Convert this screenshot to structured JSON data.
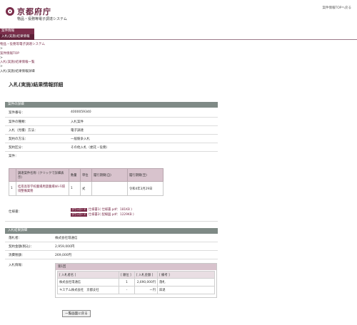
{
  "header": {
    "logo_text": "京都府庁",
    "system_name": "物品・役務等電子調達システム",
    "top_link": "案件情報TOPへ戻る"
  },
  "nav": {
    "tab1": "案件情報",
    "tab2": "入札(実施)結果情報"
  },
  "breadcrumb": {
    "item1": "物品・役務等電子調達システム",
    "sep": ">",
    "item2": "案件情報TOP",
    "item3": "入札(実施)結果情報一覧",
    "current": "入札(実施)結果情報詳細"
  },
  "page_title": "入札(実施)結果情報詳細",
  "details": {
    "section_title": "案件の詳細",
    "rows": [
      {
        "label": "案件番号：",
        "value": "4000059340"
      },
      {
        "label": "案件の種類：",
        "value": "入札案件"
      },
      {
        "label": "入札（見積）方法：",
        "value": "電子調達"
      },
      {
        "label": "契約の方法：",
        "value": "一般競争入札"
      },
      {
        "label": "契約区分：",
        "value": "その他入札（委託・役務）"
      },
      {
        "label": "案件：",
        "value": ""
      }
    ]
  },
  "items_table": {
    "headers": [
      "",
      "調達案件名称（クリックで詳細表示）",
      "数量",
      "単位",
      "履行期間(自)",
      "履行期間(至)"
    ],
    "rows": [
      {
        "no": "1",
        "name": "桂南高等学校農場用貸農場Wi-Fi環境整備業務",
        "qty": "1",
        "unit": "式",
        "from": "",
        "to": "令和4年3月29日"
      }
    ]
  },
  "spec": {
    "label": "仕様書：",
    "badge": "ダウンロード",
    "files": [
      "仕様書1( 仕様書.pdf：181KB )",
      "仕様書2( 配線図.pdf：1229KB )"
    ]
  },
  "result": {
    "section_title": "入札結果詳細",
    "winner_label": "落札者：",
    "winner": "株式会社環通信",
    "contract_label": "契約金額(税込)：",
    "contract": "2,959,000円",
    "tax_label": "消費税額：",
    "tax": "269,000円",
    "bid_label": "入札情報：",
    "round": "第1回",
    "bid_headers": [
      "[ 入札者名 ]",
      "[ 順位 ]",
      "[ 入札金額 ]",
      "[ 備考 ]"
    ],
    "bids": [
      {
        "name": "株式会社環通信",
        "rank": "1",
        "amount": "2,690,000円",
        "note": "落札"
      },
      {
        "name": "キステム株式会社　京都支社",
        "rank": "-",
        "amount": "ー円",
        "note": "辞退"
      }
    ]
  },
  "back_button": "一覧画面に戻る"
}
